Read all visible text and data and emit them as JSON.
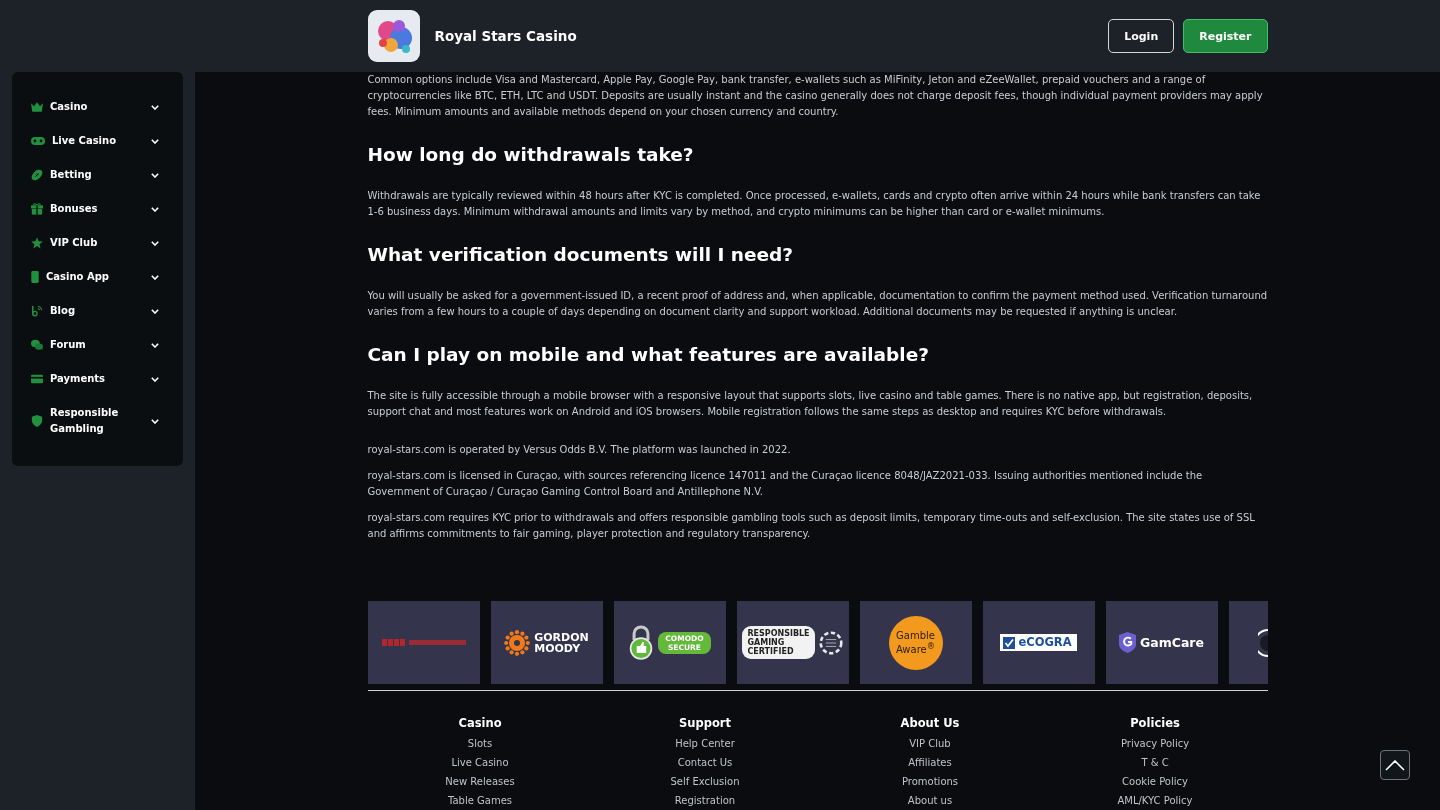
{
  "header": {
    "title": "Royal Stars Casino",
    "buttons": [
      {
        "label": "Login",
        "kind": "outline"
      },
      {
        "label": "Register",
        "kind": "primary"
      }
    ]
  },
  "sidebar": {
    "items": [
      {
        "label": "Casino",
        "kind": "crown",
        "expanded": false
      },
      {
        "label": "Live Casino",
        "kind": "gamepad",
        "expanded": false
      },
      {
        "label": "Betting",
        "kind": "ball",
        "expanded": false
      },
      {
        "label": "Bonuses",
        "kind": "gift",
        "expanded": false
      },
      {
        "label": "VIP Club",
        "kind": "star",
        "expanded": false
      },
      {
        "label": "Casino App",
        "kind": "phone",
        "expanded": false
      },
      {
        "label": "Blog",
        "kind": "blog",
        "expanded": false
      },
      {
        "label": "Forum",
        "kind": "chat",
        "expanded": false
      },
      {
        "label": "Payments",
        "kind": "card",
        "expanded": false
      },
      {
        "label": "Responsible Gambling",
        "kind": "shield",
        "expanded": false
      }
    ]
  },
  "article": {
    "blocks": [
      {
        "kind": "paragraph",
        "text": "Common options include Visa and Mastercard, Apple Pay, Google Pay, bank transfer, e-wallets such as MiFinity, Jeton and eZeeWallet, prepaid vouchers and a range of cryptocurrencies like BTC, ETH, LTC and USDT. Deposits are usually instant and the casino generally does not charge deposit fees, though individual payment providers may apply fees. Minimum amounts and available methods depend on your chosen currency and country."
      },
      {
        "kind": "heading",
        "text": "How long do withdrawals take?"
      },
      {
        "kind": "paragraph",
        "text": "Withdrawals are typically reviewed within 48 hours after KYC is completed. Once processed, e-wallets, cards and crypto often arrive within 24 hours while bank transfers can take 1-6 business days. Minimum withdrawal amounts and limits vary by method, and crypto minimums can be higher than card or e-wallet minimums."
      },
      {
        "kind": "heading",
        "text": "What verification documents will I need?"
      },
      {
        "kind": "paragraph",
        "text": "You will usually be asked for a government-issued ID, a recent proof of address and, when applicable, documentation to confirm the payment method used. Verification turnaround varies from a few hours to a couple of days depending on document clarity and support workload. Additional documents may be requested if anything is unclear."
      },
      {
        "kind": "heading",
        "text": "Can I play on mobile and what features are available?"
      },
      {
        "kind": "paragraph",
        "text": "The site is fully accessible through a mobile browser with a responsive layout that supports slots, live casino and table games. There is no native app, but registration, deposits, support chat and most features work on Android and iOS browsers. Mobile registration follows the same steps as desktop and requires KYC before withdrawals."
      }
    ],
    "notes": [
      "royal-stars.com is operated by Versus Odds B.V. The platform was launched in 2022.",
      "royal-stars.com is licensed in Curaçao, with sources referencing licence 147011 and the Curaçao licence 8048/JAZ2021-033. Issuing authorities mentioned include the Government of Curaçao / Curaçao Gaming Control Board and Antillephone N.V.",
      "royal-stars.com requires KYC prior to withdrawals and offers responsible gambling tools such as deposit limits, temporary time-outs and self-exclusion. The site states use of SSL and affirms commitments to fair gaming, player protection and regulatory transparency."
    ]
  },
  "badges": [
    {
      "kind": "wordmark"
    },
    {
      "kind": "sunburst",
      "lines": [
        "GORDON",
        "MOODY"
      ]
    },
    {
      "kind": "padlock",
      "lines": [
        "COMODO",
        "SECURE"
      ]
    },
    {
      "kind": "chip",
      "lines": [
        "RESPONSIBLE",
        "GAMING",
        "CERTIFIED"
      ]
    },
    {
      "kind": "disc",
      "lines": [
        "Gamble",
        "Aware$^{®}$"
      ]
    },
    {
      "kind": "check",
      "lines": [
        "eCOGRA"
      ]
    },
    {
      "kind": "shield",
      "lines": [
        "GamCare"
      ]
    },
    {
      "kind": "partial"
    }
  ],
  "footer": {
    "columns": [
      {
        "title": "Casino",
        "links": [
          "Slots",
          "Live Casino",
          "New Releases",
          "Table Games"
        ]
      },
      {
        "title": "Support",
        "links": [
          "Help Center",
          "Contact Us",
          "Self Exclusion",
          "Registration"
        ]
      },
      {
        "title": "About Us",
        "links": [
          "VIP Club",
          "Affiliates",
          "Promotions",
          "About us"
        ]
      },
      {
        "title": "Policies",
        "links": [
          "Privacy Policy",
          "T & C",
          "Cookie Policy",
          "AML/KYC Policy"
        ]
      }
    ]
  }
}
